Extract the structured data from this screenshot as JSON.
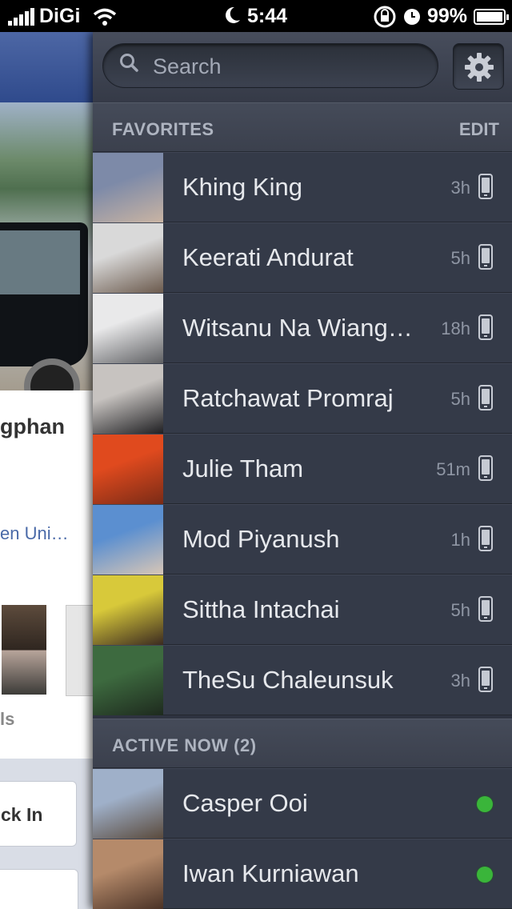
{
  "status_bar": {
    "carrier": "DiGi",
    "time": "5:44",
    "battery": "99%",
    "battery_level": 0.99,
    "icons": [
      "signal-bars-icon",
      "wifi-icon",
      "moon-icon",
      "rotation-lock-icon",
      "alarm-clock-icon",
      "battery-icon"
    ]
  },
  "background_profile": {
    "name_fragment": "gphan",
    "university_fragment": "en Uni…",
    "label_fragment": "ls",
    "button_fragment": "ck In"
  },
  "sidebar": {
    "search_placeholder": "Search",
    "settings_icon": "gear-icon",
    "favorites_header": "FAVORITES",
    "edit_label": "EDIT",
    "favorites": [
      {
        "name": "Khing King",
        "time": "3h",
        "device": "mobile-phone-icon",
        "avatar_colors": [
          "#7d8aa8",
          "#c9b4a3"
        ]
      },
      {
        "name": "Keerati Andurat",
        "time": "5h",
        "device": "mobile-phone-icon",
        "avatar_colors": [
          "#d9d9d9",
          "#6b5a4d"
        ]
      },
      {
        "name": "Witsanu Na Wiang…",
        "time": "18h",
        "device": "mobile-phone-icon",
        "avatar_colors": [
          "#e9e9ea",
          "#5f6063"
        ]
      },
      {
        "name": "Ratchawat Promraj",
        "time": "5h",
        "device": "mobile-phone-icon",
        "avatar_colors": [
          "#c7c3c0",
          "#1f1f22"
        ]
      },
      {
        "name": "Julie Tham",
        "time": "51m",
        "device": "mobile-phone-icon",
        "avatar_colors": [
          "#e04a1e",
          "#7a2b16"
        ]
      },
      {
        "name": "Mod Piyanush",
        "time": "1h",
        "device": "mobile-phone-icon",
        "avatar_colors": [
          "#5b8fd0",
          "#d8c6b6"
        ]
      },
      {
        "name": "Sittha Intachai",
        "time": "5h",
        "device": "mobile-phone-icon",
        "avatar_colors": [
          "#d8c93a",
          "#3b2a20"
        ]
      },
      {
        "name": "TheSu Chaleunsuk",
        "time": "3h",
        "device": "mobile-phone-icon",
        "avatar_colors": [
          "#3d6a3f",
          "#1e2a1e"
        ]
      }
    ],
    "active_header": "ACTIVE NOW (2)",
    "active": [
      {
        "name": "Casper Ooi",
        "status": "online",
        "avatar_colors": [
          "#9fb0c9",
          "#5a4a3c"
        ]
      },
      {
        "name": "Iwan Kurniawan",
        "status": "online",
        "avatar_colors": [
          "#b58a6a",
          "#4a3226"
        ]
      }
    ]
  },
  "colors": {
    "sidebar_bg": "#343a48",
    "online_dot": "#3ab53a",
    "facebook_blue": "#3b5998"
  }
}
